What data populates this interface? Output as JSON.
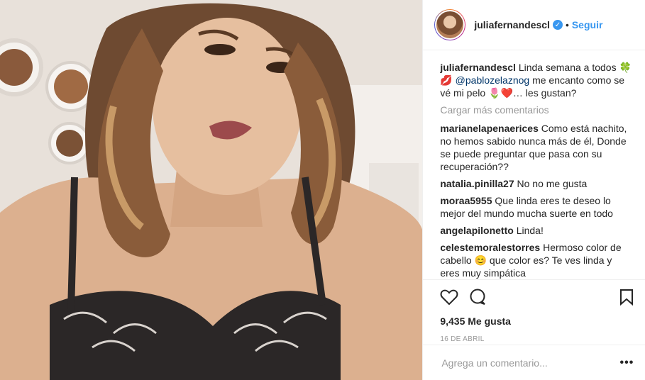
{
  "post": {
    "username": "juliafernandescl",
    "verified_icon": "verified-badge-icon",
    "follow_label": "Seguir",
    "separator": "•"
  },
  "caption": {
    "username": "juliafernandescl",
    "text_1": "Linda semana a todos 🍀",
    "emoji_lips": "💋",
    "mention": "@pablozelaznog",
    "text_2": " me encanto como se vé mi pelo 🌷❤️… les gustan?"
  },
  "load_more_label": "Cargar más comentarios",
  "comments": [
    {
      "user": "marianelapenaerices",
      "text": "Como está nachito, no hemos sabido nunca más de él, Donde se puede preguntar que pasa con su recuperación??"
    },
    {
      "user": "natalia.pinilla27",
      "text": "No no me gusta"
    },
    {
      "user": "moraa5955",
      "text": "Que linda eres te deseo lo mejor del mundo mucha suerte en todo"
    },
    {
      "user": "angelapilonetto",
      "text": "Linda!"
    },
    {
      "user": "celestemoralestorres",
      "text": "Hermoso color de cabello 😊 que color es? Te ves linda y eres muy simpática"
    }
  ],
  "likes_label": "9,435 Me gusta",
  "date_label": "16 DE ABRIL",
  "comment_input": {
    "placeholder": "Agrega un comentario...",
    "value": ""
  },
  "more_label": "•••",
  "icons": {
    "like": "heart-icon",
    "comment": "comment-icon",
    "save": "bookmark-icon"
  },
  "colors": {
    "link": "#3897f0",
    "text": "#262626",
    "muted": "#999999",
    "border": "#efefef"
  }
}
